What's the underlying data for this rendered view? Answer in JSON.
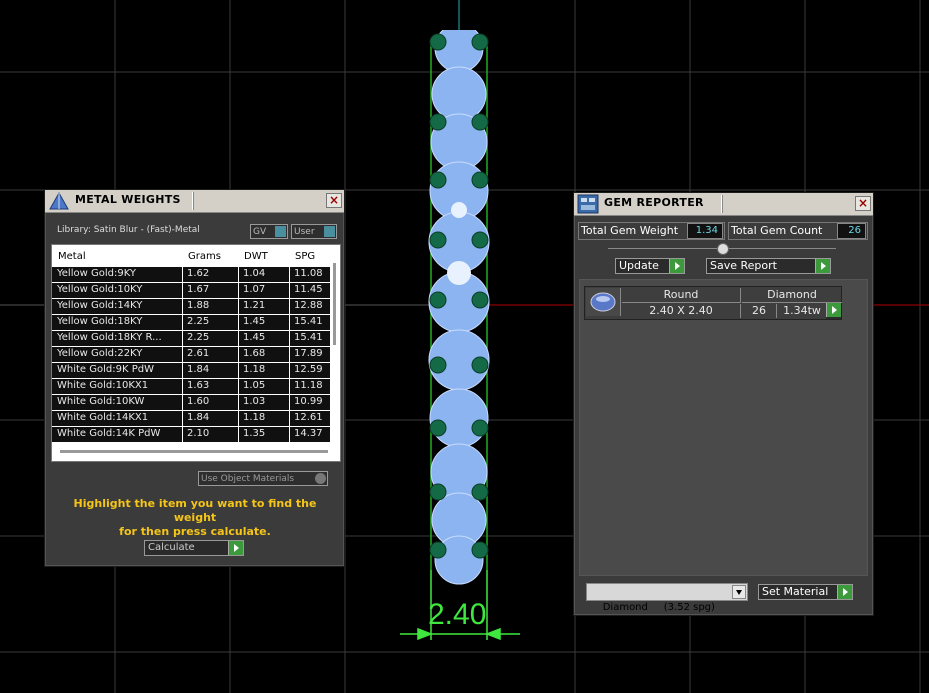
{
  "metal_weights": {
    "title": "METAL WEIGHTS",
    "library_label": "Library: Satin Blur - (Fast)-Metal",
    "gv_label": "GV",
    "user_label": "User",
    "columns": [
      "Metal",
      "Grams",
      "DWT",
      "SPG"
    ],
    "rows": [
      {
        "metal": "Yellow Gold:9KY",
        "grams": "1.62",
        "dwt": "1.04",
        "spg": "11.08"
      },
      {
        "metal": "Yellow Gold:10KY",
        "grams": "1.67",
        "dwt": "1.07",
        "spg": "11.45"
      },
      {
        "metal": "Yellow Gold:14KY",
        "grams": "1.88",
        "dwt": "1.21",
        "spg": "12.88"
      },
      {
        "metal": "Yellow Gold:18KY",
        "grams": "2.25",
        "dwt": "1.45",
        "spg": "15.41"
      },
      {
        "metal": "Yellow Gold:18KY R...",
        "grams": "2.25",
        "dwt": "1.45",
        "spg": "15.41"
      },
      {
        "metal": "Yellow Gold:22KY",
        "grams": "2.61",
        "dwt": "1.68",
        "spg": "17.89"
      },
      {
        "metal": "White Gold:9K PdW",
        "grams": "1.84",
        "dwt": "1.18",
        "spg": "12.59"
      },
      {
        "metal": "White Gold:10KX1",
        "grams": "1.63",
        "dwt": "1.05",
        "spg": "11.18"
      },
      {
        "metal": "White Gold:10KW",
        "grams": "1.60",
        "dwt": "1.03",
        "spg": "10.99"
      },
      {
        "metal": "White Gold:14KX1",
        "grams": "1.84",
        "dwt": "1.18",
        "spg": "12.61"
      },
      {
        "metal": "White Gold:14K PdW",
        "grams": "2.10",
        "dwt": "1.35",
        "spg": "14.37"
      }
    ],
    "use_object_materials": "Use Object Materials",
    "hint_line1": "Highlight the item you want to find the weight",
    "hint_line2": "for then press calculate.",
    "calculate_label": "Calculate"
  },
  "gem_reporter": {
    "title": "GEM REPORTER",
    "total_weight_label": "Total Gem Weight",
    "total_weight_value": "1.34",
    "total_count_label": "Total Gem Count",
    "total_count_value": "26",
    "update_label": "Update",
    "save_report_label": "Save Report",
    "gem": {
      "shape": "Round",
      "material": "Diamond",
      "size": "2.40 X 2.40",
      "count": "26",
      "weight": "1.34tw"
    },
    "material_select": "Diamond     (3.52 spg)",
    "set_material_label": "Set Material"
  },
  "viewport": {
    "dimension_label": "2.40",
    "dimension_color": "#3fe83f"
  }
}
